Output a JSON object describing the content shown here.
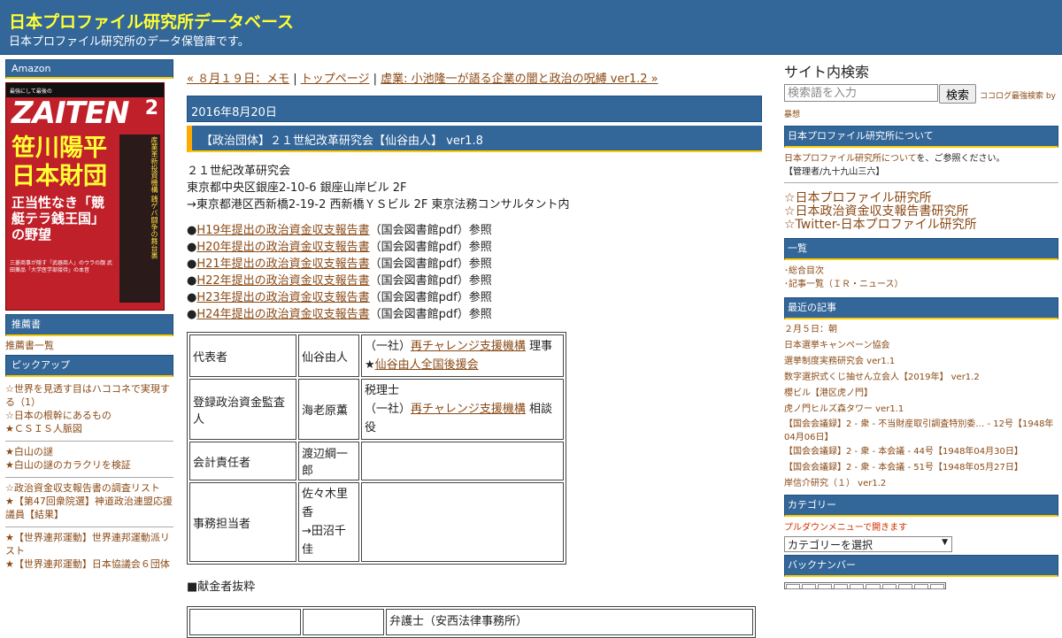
{
  "header": {
    "title": "日本プロファイル研究所データベース",
    "description": "日本プロファイル研究所のデータ保管庫です。"
  },
  "left": {
    "amazon": "Amazon",
    "magazine": {
      "top": "最強にして最後の",
      "logo": "ZAITEN",
      "issue": "2",
      "headline1": "笹川陽平",
      "headline2": "日本財団",
      "sub": "正当性なき「競艇テラ銭王国」の野望",
      "vertical": "産業革新投資機構 銭ゲバ闘争の舞台裏",
      "small": "三菱商事が隠す「武器商人」のウラの顔 武田薬品「大学医学部接待」の本音"
    },
    "recommend_header": "推薦書",
    "recommend_link": "推薦書一覧",
    "pickup_header": "ピックアップ",
    "groups": [
      [
        "☆世界を見透す目はハココネで実現する（1）",
        "☆日本の根幹にあるもの",
        "★ＣＳＩＳ人脈図"
      ],
      [
        "★白山の謎",
        "★白山の謎のカラクリを検証"
      ],
      [
        "☆政治資金収支報告書の調査リスト",
        "★【第47回衆院選】神道政治連盟応援議員【結果】"
      ],
      [
        "★【世界連邦運動】世界連邦運動派リスト",
        "★【世界連邦運動】日本協議会６団体"
      ]
    ]
  },
  "main": {
    "nav": {
      "prev": "« ８月１９日：メモ",
      "sep1": " | ",
      "home": "トップページ",
      "sep2": " | ",
      "next": "虚業: 小池隆一が語る企業の闇と政治の呪縛 ver1.2 »"
    },
    "date": "2016年8月20日",
    "title": "【政治団体】２１世紀改革研究会【仙谷由人】 ver1.8",
    "address": [
      "２１世紀改革研究会",
      "東京都中央区銀座2-10-6 銀座山岸ビル 2F",
      "→東京都港区西新橋2-19-2 西新橋ＹＳビル 2F 東京法務コンサルタント内"
    ],
    "reports": [
      {
        "label": "H19年提出の政治資金収支報告書",
        "note": "（国会図書館pdf）参照"
      },
      {
        "label": "H20年提出の政治資金収支報告書",
        "note": "（国会図書館pdf）参照"
      },
      {
        "label": "H21年提出の政治資金収支報告書",
        "note": "（国会図書館pdf）参照"
      },
      {
        "label": "H22年提出の政治資金収支報告書",
        "note": "（国会図書館pdf）参照"
      },
      {
        "label": "H23年提出の政治資金収支報告書",
        "note": "（国会図書館pdf）参照"
      },
      {
        "label": "H24年提出の政治資金収支報告書",
        "note": "（国会図書館pdf）参照"
      }
    ],
    "bullet": "●",
    "table": {
      "r1": {
        "role": "代表者",
        "name": "仙谷由人",
        "a_pre": "（一社）",
        "a_link": "再チャレンジ支援機構",
        "a_post": " 理事",
        "b_pre": "★",
        "b_link": "仙谷由人全国後援会"
      },
      "r2": {
        "role": "登録政治資金監査人",
        "name": "海老原薫",
        "a": "税理士",
        "b_pre": "（一社）",
        "b_link": "再チャレンジ支援機構",
        "b_post": " 相談役"
      },
      "r3": {
        "role": "会計責任者",
        "name": "渡辺綱一郎"
      },
      "r4": {
        "role": "事務担当者",
        "name1": "佐々木里香",
        "name2": "→田沼千佳"
      }
    },
    "kenkin": "■献金者抜粋",
    "t2_cell": "弁護士（安西法律事務所）"
  },
  "right": {
    "search_title": "サイト内検索",
    "search_placeholder": "検索語を入力",
    "search_button": "検索",
    "powered": "ココログ最強検索 by",
    "powered2": "暴想",
    "about_header": "日本プロファイル研究所について",
    "about_text": "日本プロファイル研究所について",
    "about_suffix": "を、ご参照ください。",
    "admin": "【管理者/九十九山三六】",
    "big_links": [
      "☆日本プロファイル研究所",
      "☆日本政治資金収支報告書研究所",
      "☆Twitter-日本プロファイル研究所"
    ],
    "list_header": "一覧",
    "list_items": [
      "･総合目次",
      "･記事一覧（ＩＲ・ニュース）"
    ],
    "recent_header": "最近の記事",
    "recent": [
      "２月５日：朝",
      "日本選挙キャンペーン協会",
      "選挙制度実務研究会 ver1.1",
      "数字選択式くじ抽せん立会人【2019年】 ver1.2",
      "櫻ビル【港区虎ノ門】",
      "虎ノ門ヒルズ森タワー ver1.1",
      "【国会会議録】2 - 衆 - 不当財産取引調査特別委… - 12号【1948年04月06日】",
      "【国会会議録】2 - 衆 - 本会議 - 44号【1948年04月30日】",
      "【国会会議録】2 - 衆 - 本会議 - 51号【1948年05月27日】",
      "岸信介研究（１） ver1.2"
    ],
    "category_header": "カテゴリー",
    "category_note": "プルダウンメニューで開きます",
    "category_select": "カテゴリーを選択",
    "backnumber_header": "バックナンバー"
  }
}
